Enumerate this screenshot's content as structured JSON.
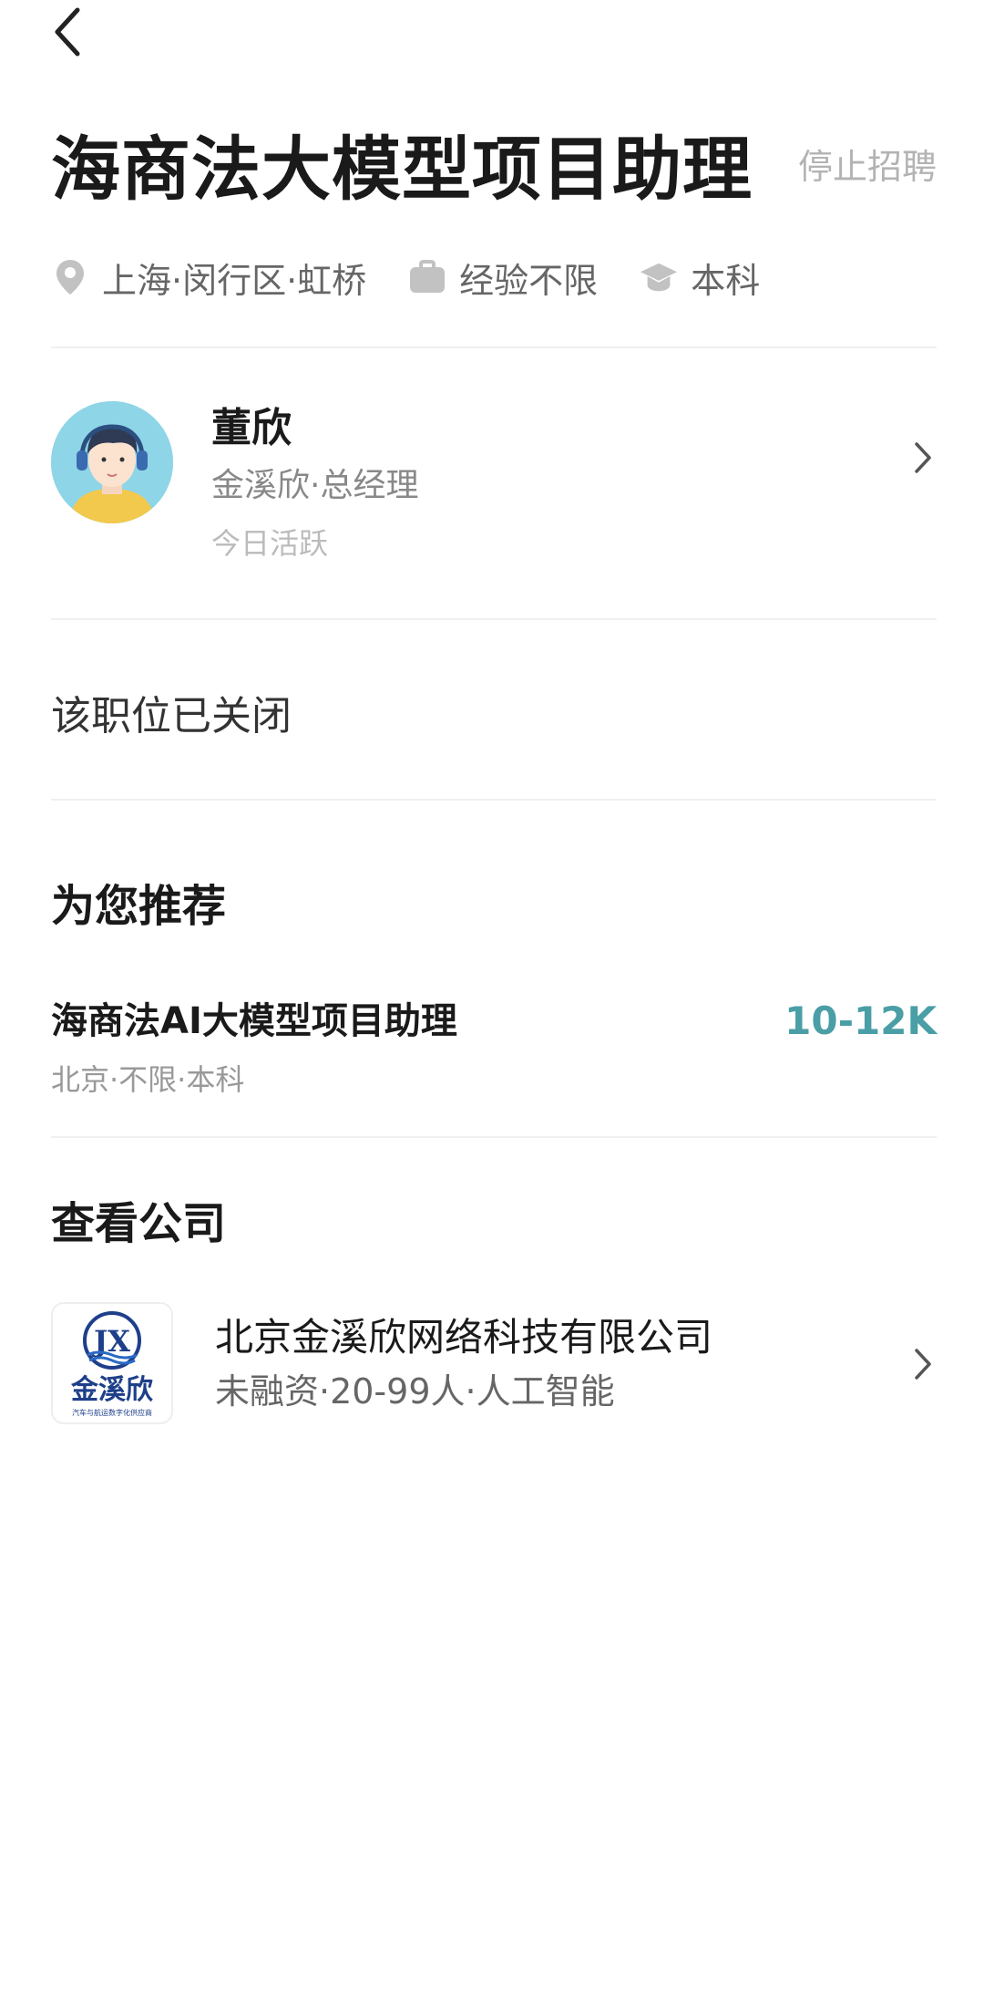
{
  "header": {
    "back_icon": "chevron-left-icon"
  },
  "job": {
    "title": "海商法大模型项目助理",
    "stop_label": "停止招聘",
    "location": "上海·闵行区·虹桥",
    "experience": "经验不限",
    "education": "本科",
    "location_icon": "location-pin-icon",
    "experience_icon": "briefcase-icon",
    "education_icon": "graduation-cap-icon"
  },
  "recruiter": {
    "name": "董欣",
    "title": "金溪欣·总经理",
    "status": "今日活跃",
    "avatar_icon": "avatar"
  },
  "notice": {
    "closed_text": "该职位已关闭"
  },
  "recommend": {
    "heading": "为您推荐",
    "jobs": [
      {
        "title": "海商法AI大模型项目助理",
        "salary": "10-12K",
        "meta": "北京·不限·本科"
      }
    ]
  },
  "company_section": {
    "heading": "查看公司",
    "name": "北京金溪欣网络科技有限公司",
    "meta": "未融资·20-99人·人工智能",
    "logo_text": "金溪欣",
    "logo_mark": "JX",
    "logo_tagline": "汽车与航运数字化供应商"
  },
  "colors": {
    "accent_salary": "#4a9ea6",
    "muted_text": "#b3b3b3",
    "divider": "#f0f0f0"
  }
}
